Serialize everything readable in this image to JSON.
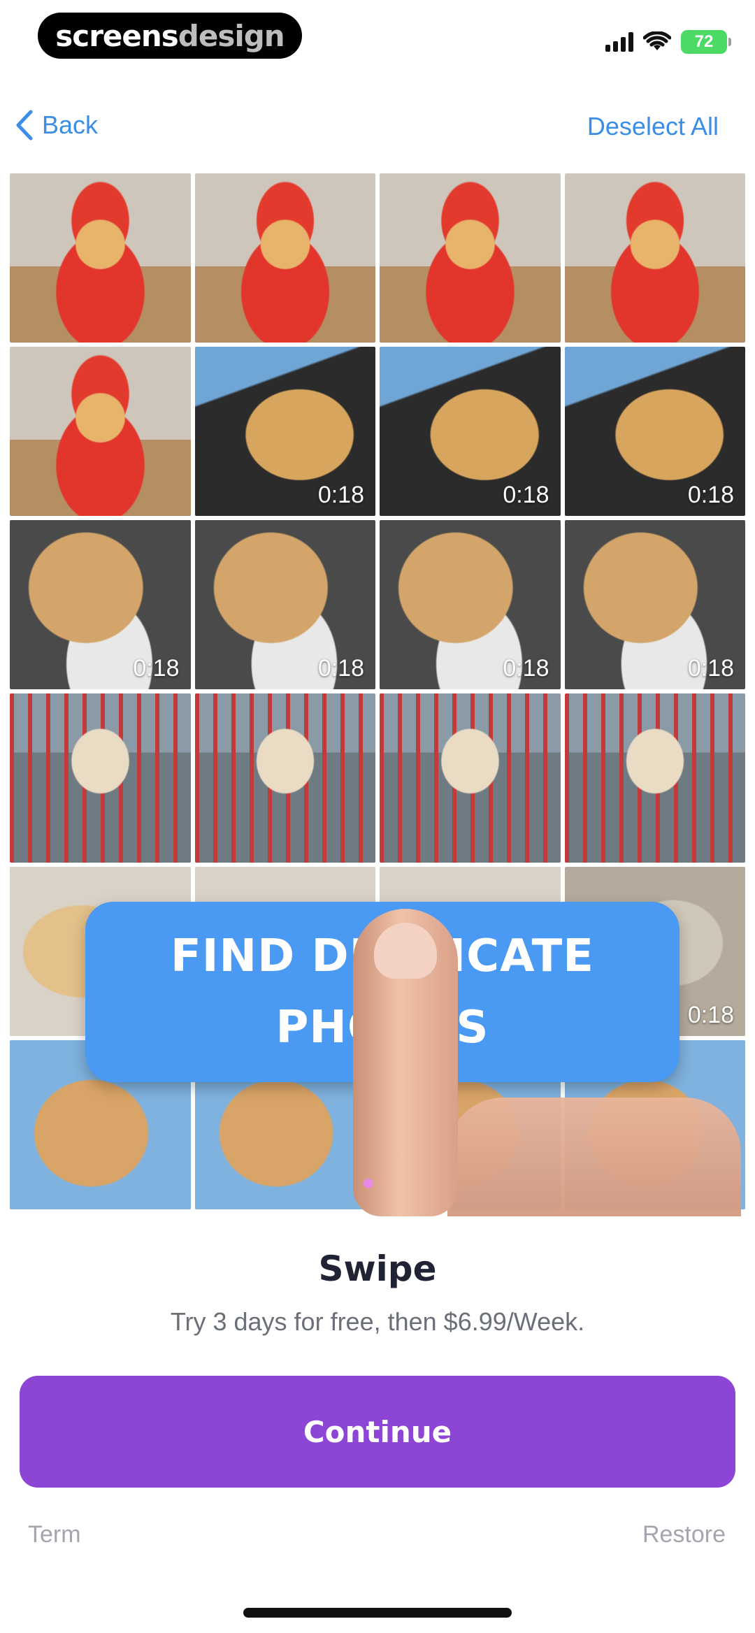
{
  "watermark": {
    "bold": "screens",
    "light": "design"
  },
  "status_bar": {
    "battery": "72"
  },
  "nav": {
    "back_label": "Back",
    "deselect_label": "Deselect All"
  },
  "grid": {
    "cells": [
      {
        "photo": "lobster",
        "duration": ""
      },
      {
        "photo": "lobster",
        "duration": ""
      },
      {
        "photo": "lobster",
        "duration": ""
      },
      {
        "photo": "lobster",
        "duration": ""
      },
      {
        "photo": "lobster",
        "duration": ""
      },
      {
        "photo": "lick",
        "duration": "0:18"
      },
      {
        "photo": "lick",
        "duration": "0:18"
      },
      {
        "photo": "lick",
        "duration": "0:18"
      },
      {
        "photo": "cup",
        "duration": "0:18"
      },
      {
        "photo": "cup",
        "duration": "0:18"
      },
      {
        "photo": "cup",
        "duration": "0:18"
      },
      {
        "photo": "cup",
        "duration": "0:18"
      },
      {
        "photo": "cart",
        "duration": ""
      },
      {
        "photo": "cart",
        "duration": ""
      },
      {
        "photo": "cart",
        "duration": ""
      },
      {
        "photo": "cart",
        "duration": ""
      },
      {
        "photo": "puppy",
        "duration": ""
      },
      {
        "photo": "puppy",
        "duration": ""
      },
      {
        "photo": "puppy",
        "duration": ""
      },
      {
        "photo": "car",
        "duration": "0:18"
      },
      {
        "photo": "smile",
        "duration": ""
      },
      {
        "photo": "smile",
        "duration": ""
      },
      {
        "photo": "smile",
        "duration": ""
      },
      {
        "photo": "smile",
        "duration": ""
      }
    ]
  },
  "overlay": {
    "line1": "FIND DUPLICATE",
    "line2": "PHOTOS"
  },
  "paywall": {
    "title": "Swipe",
    "subtitle": "Try 3 days for free, then $6.99/Week.",
    "continue_label": "Continue",
    "term_label": "Term",
    "restore_label": "Restore"
  },
  "colors": {
    "accent_blue": "#3a8ee6",
    "button_purple": "#8c45d4",
    "banner_blue": "#4a99f2"
  }
}
